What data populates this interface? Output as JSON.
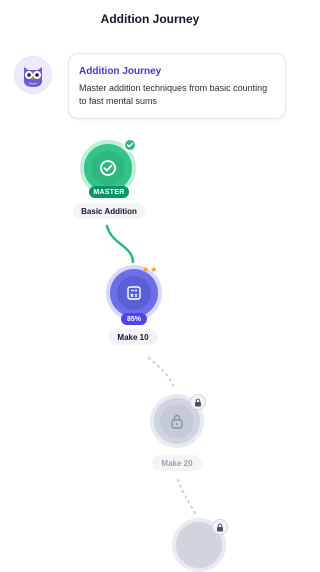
{
  "header": {
    "title": "Addition Journey"
  },
  "intro_card": {
    "title": "Addition Journey",
    "description": "Master addition techniques from basic counting to fast mental sums"
  },
  "nodes": [
    {
      "label": "Basic Addition",
      "status": "mastered",
      "badge": "MASTER",
      "icon": "check-icon"
    },
    {
      "label": "Make 10",
      "status": "in-progress",
      "progress_text": "85%",
      "progress": 0.85,
      "stars": "★★",
      "stars_earned": 2,
      "icon": "calculator-icon"
    },
    {
      "label": "Make 20",
      "status": "locked",
      "icon": "lock-icon"
    },
    {
      "label": "",
      "status": "locked",
      "icon": "lock-icon"
    }
  ],
  "colors": {
    "mastered": "#34c48a",
    "in_progress": "#6a6ee8",
    "locked": "#cfd4df",
    "accent_text": "#4338ca",
    "star": "#f59e0b"
  }
}
